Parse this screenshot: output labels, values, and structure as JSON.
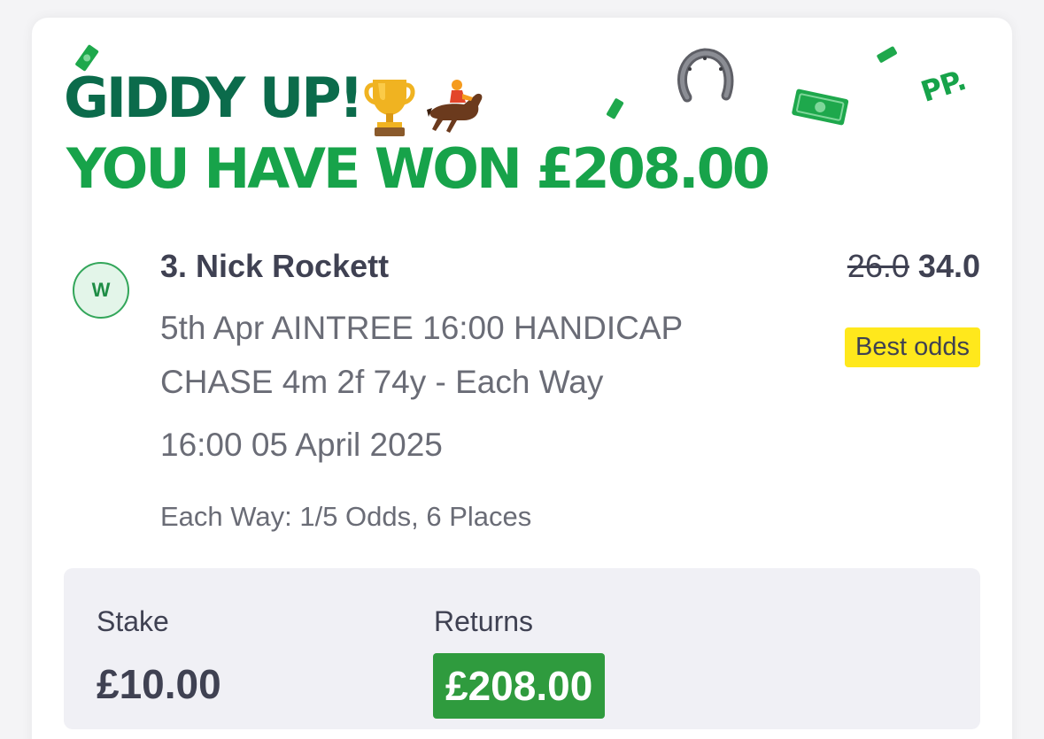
{
  "header": {
    "line1": "GIDDY UP!",
    "line2": "YOU HAVE WON £208.00",
    "brand_mark": "PP."
  },
  "icons": [
    "trophy-icon",
    "jockey-horse-icon",
    "horseshoe-icon",
    "cash-note-icon",
    "brand-logo-icon"
  ],
  "selection": {
    "result_badge": "W",
    "name": "3. Nick Rockett",
    "description": "5th Apr AINTREE 16:00 HANDICAP CHASE 4m 2f 74y - Each Way",
    "datetime": "16:00 05 April 2025",
    "each_way_terms": "Each Way: 1/5 Odds, 6 Places",
    "odds_old": "26.0",
    "odds_new": "34.0",
    "best_odds_label": "Best odds"
  },
  "summary": {
    "stake_label": "Stake",
    "stake_value": "£10.00",
    "returns_label": "Returns",
    "returns_value": "£208.00"
  },
  "colors": {
    "dark_green": "#0b6b4b",
    "bright_green": "#17a34a",
    "returns_green": "#2f9b3e",
    "best_odds_yellow": "#ffe81c",
    "text_dark": "#3f4152",
    "text_grey": "#6a6c76"
  }
}
